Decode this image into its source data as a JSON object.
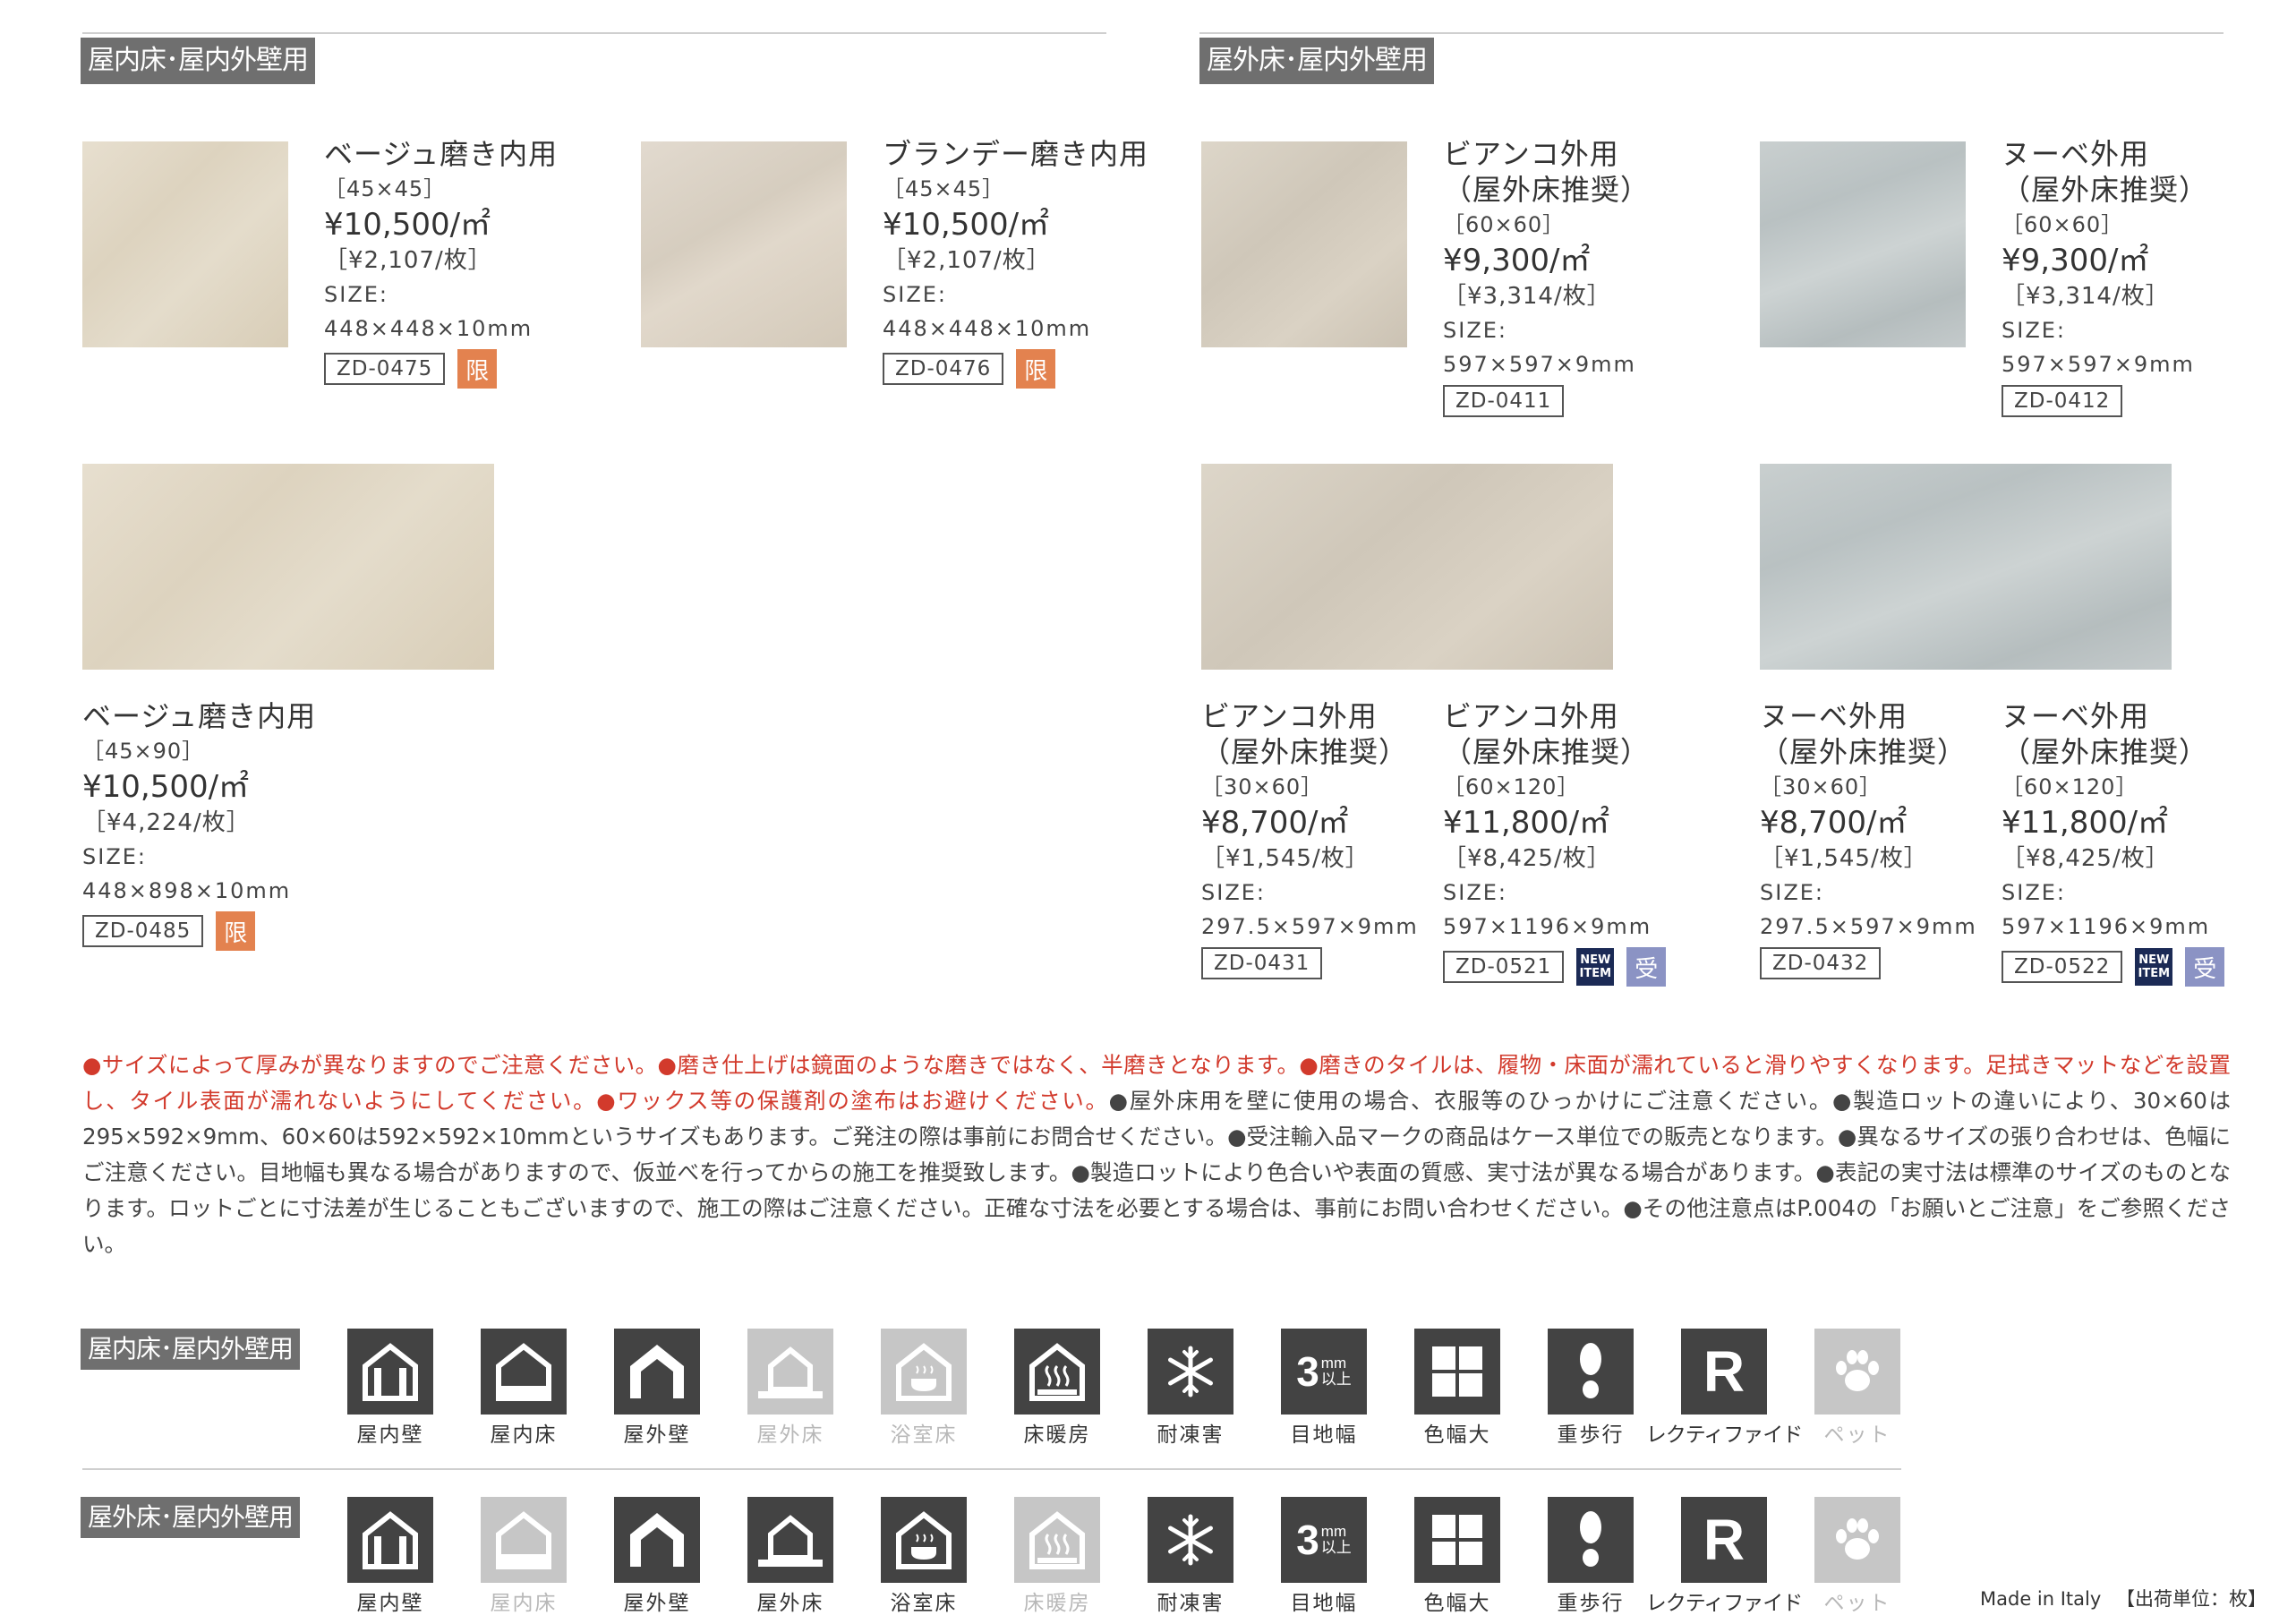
{
  "sections": {
    "indoor_tag": "屋内床･屋内外壁用",
    "outdoor_tag": "屋外床･屋内外壁用"
  },
  "products": {
    "p0475": {
      "name": "ベージュ磨き内用",
      "dim": "［45×45］",
      "price": "¥10,500/㎡",
      "per_piece": "［¥2,107/枚］",
      "size_label": "SIZE:",
      "size": "448×448×10mm",
      "code": "ZD-0475",
      "badge": "限"
    },
    "p0476": {
      "name": "ブランデー磨き内用",
      "dim": "［45×45］",
      "price": "¥10,500/㎡",
      "per_piece": "［¥2,107/枚］",
      "size_label": "SIZE:",
      "size": "448×448×10mm",
      "code": "ZD-0476",
      "badge": "限"
    },
    "p0485": {
      "name": "ベージュ磨き内用",
      "dim": "［45×90］",
      "price": "¥10,500/㎡",
      "per_piece": "［¥4,224/枚］",
      "size_label": "SIZE:",
      "size": "448×898×10mm",
      "code": "ZD-0485",
      "badge": "限"
    },
    "p0411": {
      "name_1": "ビアンコ外用",
      "name_2": "（屋外床推奨）",
      "dim": "［60×60］",
      "price": "¥9,300/㎡",
      "per_piece": "［¥3,314/枚］",
      "size_label": "SIZE:",
      "size": "597×597×9mm",
      "code": "ZD-0411"
    },
    "p0412": {
      "name_1": "ヌーベ外用",
      "name_2": "（屋外床推奨）",
      "dim": "［60×60］",
      "price": "¥9,300/㎡",
      "per_piece": "［¥3,314/枚］",
      "size_label": "SIZE:",
      "size": "597×597×9mm",
      "code": "ZD-0412"
    },
    "p0431": {
      "name_1": "ビアンコ外用",
      "name_2": "（屋外床推奨）",
      "dim": "［30×60］",
      "price": "¥8,700/㎡",
      "per_piece": "［¥1,545/枚］",
      "size_label": "SIZE:",
      "size": "297.5×597×9mm",
      "code": "ZD-0431"
    },
    "p0521": {
      "name_1": "ビアンコ外用",
      "name_2": "（屋外床推奨）",
      "dim": "［60×120］",
      "price": "¥11,800/㎡",
      "per_piece": "［¥8,425/枚］",
      "size_label": "SIZE:",
      "size": "597×1196×9mm",
      "code": "ZD-0521",
      "new_badge": "NEW ITEM",
      "badge": "受"
    },
    "p0432": {
      "name_1": "ヌーベ外用",
      "name_2": "（屋外床推奨）",
      "dim": "［30×60］",
      "price": "¥8,700/㎡",
      "per_piece": "［¥1,545/枚］",
      "size_label": "SIZE:",
      "size": "297.5×597×9mm",
      "code": "ZD-0432"
    },
    "p0522": {
      "name_1": "ヌーベ外用",
      "name_2": "（屋外床推奨）",
      "dim": "［60×120］",
      "price": "¥11,800/㎡",
      "per_piece": "［¥8,425/枚］",
      "size_label": "SIZE:",
      "size": "597×1196×9mm",
      "code": "ZD-0522",
      "new_badge": "NEW ITEM",
      "badge": "受"
    }
  },
  "notes": {
    "red_1": "●サイズによって厚みが異なりますのでご注意ください。●磨き仕上げは鏡面のような磨きではなく、半磨きとなります。●磨きのタイルは、履物・床面が濡れていると滑りやすくなります。足拭きマットなどを設置し、タイル表面が濡れないようにしてください。●ワックス等の保護剤の塗布はお避けください。",
    "black_1": "●屋外床用を壁に使用の場合、衣服等のひっかけにご注意ください。●製造ロットの違いにより、30×60は295×592×9mm、60×60は592×592×10mmというサイズもあります。ご発注の際は事前にお問合せください。●受注輸入品マークの商品はケース単位での販売となります。●異なるサイズの張り合わせは、色幅にご注意ください。目地幅も異なる場合がありますので、仮並べを行ってからの施工を推奨致します。●製造ロットにより色合いや表面の質感、実寸法が異なる場合があります。●表記の実寸法は標準のサイズのものとなります。ロットごとに寸法差が生じることもございますので、施工の際はご注意ください。正確な寸法を必要とする場合は、事前にお問い合わせください。●その他注意点はP.004の「お願いとご注意」をご参照ください。"
  },
  "icon_labels": [
    "屋内壁",
    "屋内床",
    "屋外壁",
    "屋外床",
    "浴室床",
    "床暖房",
    "耐凍害",
    "目地幅",
    "色幅大",
    "重歩行",
    "レクティファイド",
    "ペット"
  ],
  "icon_joint_text": {
    "num": "3",
    "unit": "mm",
    "sub": "以上"
  },
  "icon_rect_letter": "R",
  "icon_rows": {
    "indoor": {
      "tag": "屋内床･屋内外壁用",
      "active": [
        true,
        true,
        true,
        false,
        false,
        true,
        true,
        true,
        true,
        true,
        true,
        false
      ]
    },
    "outdoor": {
      "tag": "屋外床･屋内外壁用",
      "active": [
        true,
        false,
        true,
        true,
        true,
        false,
        true,
        true,
        true,
        true,
        true,
        false
      ]
    }
  },
  "footer": {
    "made_in": "Made in Italy",
    "unit": "【出荷単位：枚】"
  },
  "colors": {
    "badge_limited": "#e3824f",
    "badge_order": "#8b93c4",
    "badge_new": "#1b2a55",
    "notes_red": "#d23a2c",
    "icon_active": "#434343",
    "icon_inactive": "#c6c6c6"
  }
}
